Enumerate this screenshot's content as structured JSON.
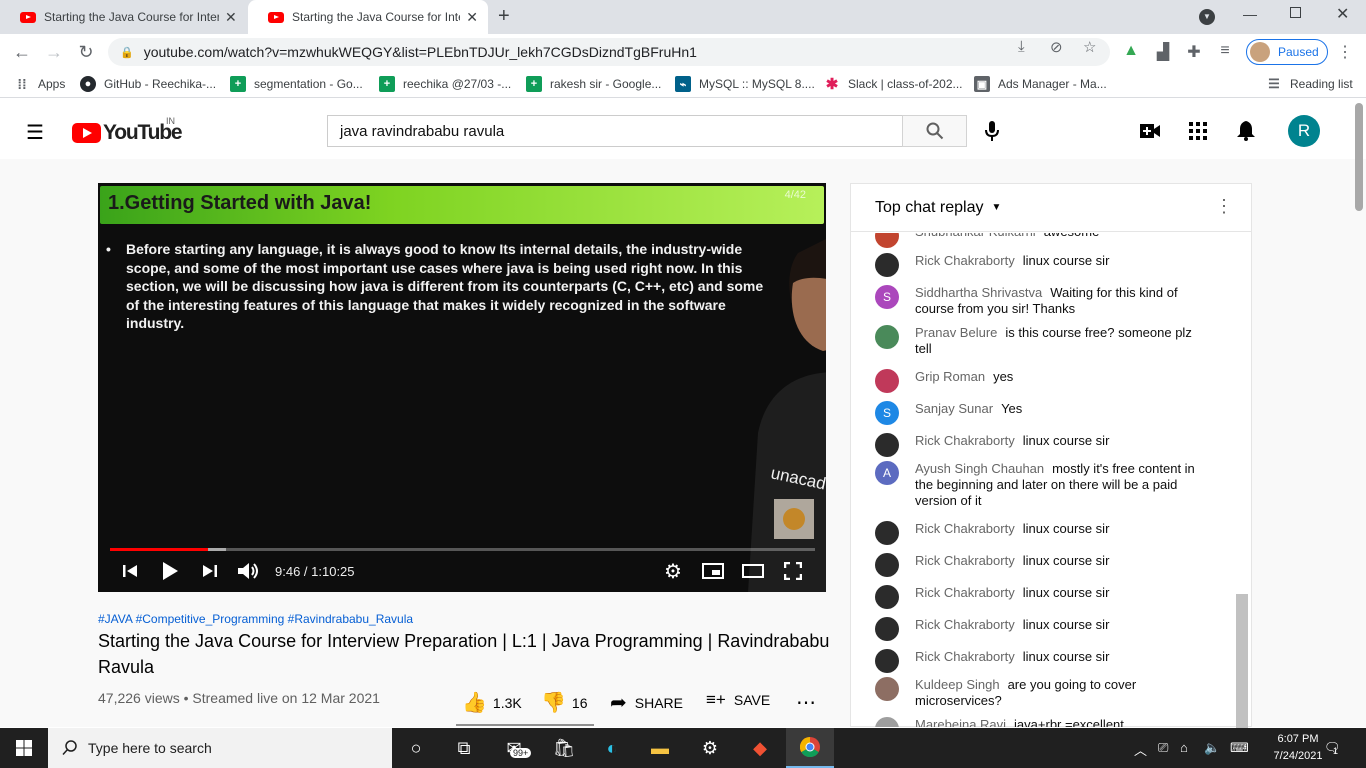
{
  "browser": {
    "tabs": [
      {
        "title": "Starting the Java Course for Inter",
        "active": false
      },
      {
        "title": "Starting the Java Course for Inter",
        "active": true
      }
    ],
    "new_tab_icon": "plus-icon",
    "url": "youtube.com/watch?v=mzwhukWEQGY&list=PLEbnTDJUr_lekh7CGDsDizndTgBFruHn1",
    "profile_status": "Paused",
    "bookmarks": [
      "Apps",
      "GitHub - Reechika-...",
      "segmentation - Go...",
      "reechika @27/03 -...",
      "rakesh sir - Google...",
      "MySQL :: MySQL 8....",
      "Slack | class-of-202...",
      "Ads Manager - Ma..."
    ],
    "reading_list": "Reading list"
  },
  "youtube": {
    "logo_text": "YouTube",
    "country_code": "IN",
    "search_value": "java ravindrababu ravula",
    "avatar_letter": "R"
  },
  "player": {
    "slide_title": "1.Getting Started with Java!",
    "slide_number": "4/42",
    "slide_text": "Before starting any language, it is always good to know Its internal details, the industry-wide scope, and some of the most important use cases where java is being used right now. In this section, we will be discussing how java is different from its counterparts (C, C++, etc) and some of the interesting features of this language that makes it widely recognized in the software industry.",
    "watermark": "unacademy",
    "time": "9:46 / 1:10:25",
    "played_fraction": 0.1386,
    "buffered_fraction": 0.165
  },
  "video": {
    "hashtags": "#JAVA #Competitive_Programming #Ravindrababu_Ravula",
    "title": "Starting the Java Course for Interview Preparation | L:1 | Java Programming | Ravindrababu Ravula",
    "views": "47,226 views • Streamed live on 12 Mar 2021",
    "likes": "1.3K",
    "dislikes": "16",
    "share": "SHARE",
    "save": "SAVE"
  },
  "chat": {
    "header": "Top chat replay",
    "messages": [
      {
        "name": "Shubhankar Kulkarni",
        "text": "awesome",
        "avatar": "",
        "color": "#c2452f"
      },
      {
        "name": "Rick Chakraborty",
        "text": "linux course sir",
        "avatar": "",
        "color": "#2b2b2b"
      },
      {
        "name": "Siddhartha Shrivastva",
        "text": "Waiting for this kind of course from you sir! Thanks",
        "avatar": "S",
        "color": "#ab47bc"
      },
      {
        "name": "Pranav Belure",
        "text": "is this course free? someone plz tell",
        "avatar": "",
        "color": "#4a8a5a"
      },
      {
        "name": "Grip Roman",
        "text": "yes",
        "avatar": "",
        "color": "#c0395a"
      },
      {
        "name": "Sanjay Sunar",
        "text": "Yes",
        "avatar": "S",
        "color": "#1e88e5"
      },
      {
        "name": "Rick Chakraborty",
        "text": "linux course sir",
        "avatar": "",
        "color": "#2b2b2b"
      },
      {
        "name": "Ayush Singh Chauhan",
        "text": "mostly it's free content in the beginning and later on there will be a paid version of it",
        "avatar": "A",
        "color": "#5c6bc0"
      },
      {
        "name": "Rick Chakraborty",
        "text": "linux course sir",
        "avatar": "",
        "color": "#2b2b2b"
      },
      {
        "name": "Rick Chakraborty",
        "text": "linux course sir",
        "avatar": "",
        "color": "#2b2b2b"
      },
      {
        "name": "Rick Chakraborty",
        "text": "linux course sir",
        "avatar": "",
        "color": "#2b2b2b"
      },
      {
        "name": "Rick Chakraborty",
        "text": "linux course sir",
        "avatar": "",
        "color": "#2b2b2b"
      },
      {
        "name": "Rick Chakraborty",
        "text": "linux course sir",
        "avatar": "",
        "color": "#2b2b2b"
      },
      {
        "name": "Kuldeep Singh",
        "text": "are you going to cover microservices?",
        "avatar": "",
        "color": "#8d6e63"
      },
      {
        "name": "Marebeina Ravi",
        "text": "java+rbr =excellent",
        "avatar": "",
        "color": "#9e9e9e"
      }
    ]
  },
  "taskbar": {
    "search_placeholder": "Type here to search",
    "mail_badge": "99+",
    "time": "6:07 PM",
    "date": "7/24/2021",
    "notification_count": "1"
  }
}
